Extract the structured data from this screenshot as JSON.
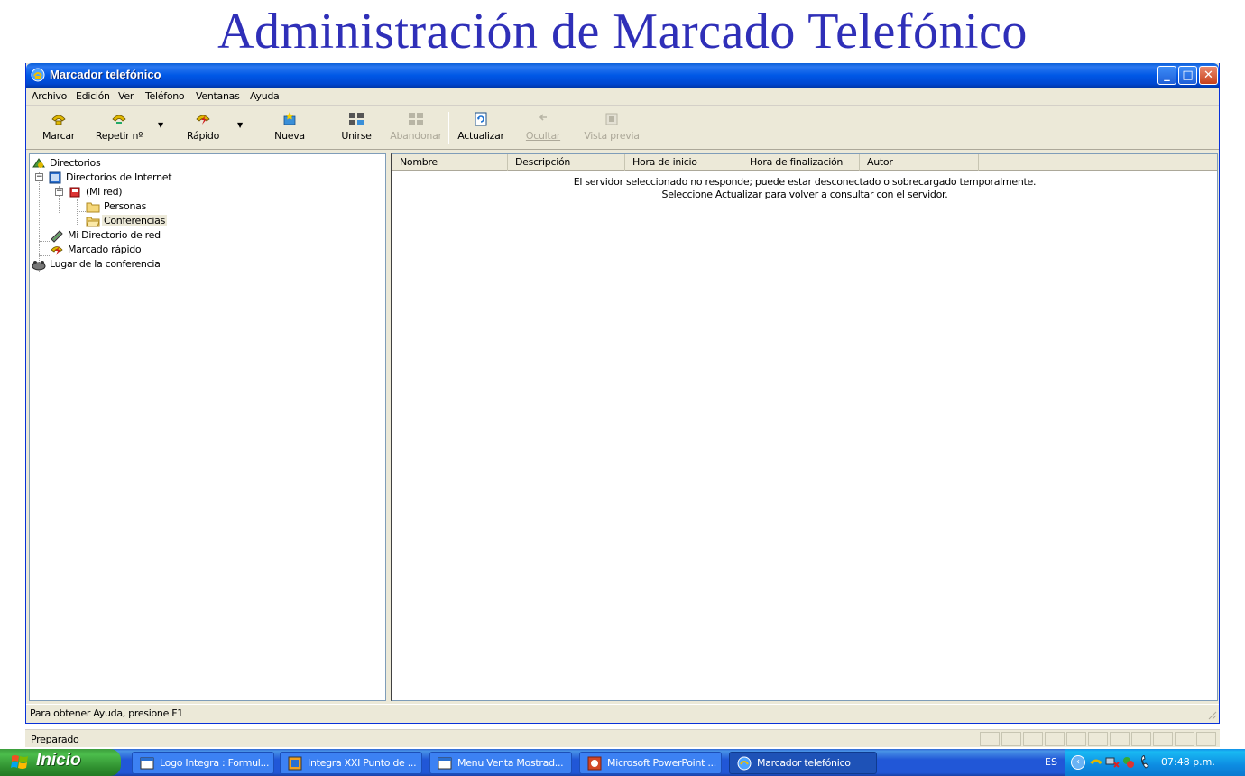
{
  "slide": {
    "title": "Administración de Marcado Telefónico"
  },
  "window": {
    "title": "Marcador telefónico",
    "controls": {
      "minimize": "_",
      "maximize": "□",
      "close": "✕"
    }
  },
  "menu": [
    "Archivo",
    "Edición",
    "Ver",
    "Teléfono",
    "Ventanas",
    "Ayuda"
  ],
  "toolbar": {
    "marcar": "Marcar",
    "repetir": "Repetir nº",
    "rapido": "Rápido",
    "nueva": "Nueva",
    "unirse": "Unirse",
    "abandonar": "Abandonar",
    "actualizar": "Actualizar",
    "ocultar": "Ocultar",
    "vista_previa": "Vista previa",
    "dropdown_glyph": "▼"
  },
  "tree": {
    "directorios": "Directorios",
    "internet": "Directorios de Internet",
    "mi_red": "(Mi red)",
    "personas": "Personas",
    "conferencias": "Conferencias",
    "mi_directorio": "Mi Directorio de red",
    "marcado_rapido": "Marcado rápido",
    "lugar": "Lugar de la conferencia",
    "collapse_glyph": "−"
  },
  "list": {
    "columns": [
      "Nombre",
      "Descripción",
      "Hora de inicio",
      "Hora de finalización",
      "Autor"
    ],
    "message_line1": "El servidor seleccionado no responde; puede estar desconectado o sobrecargado temporalmente.",
    "message_line2": "Seleccione Actualizar para volver a consultar con el servidor."
  },
  "status": {
    "window_status": "Para obtener Ayuda, presione F1",
    "outer_status": "Preparado"
  },
  "taskbar": {
    "start": "Inicio",
    "tasks": [
      "Logo Integra : Formul...",
      "Integra XXI Punto de ...",
      "Menu Venta Mostrad...",
      "Microsoft PowerPoint ...",
      "Marcador telefónico"
    ],
    "language": "ES",
    "chevron": "‹",
    "clock": "07:48 p.m."
  },
  "colors": {
    "title_blue": "#2f2fb8",
    "xp_blue": "#0058e6",
    "start_green": "#3c9d3c",
    "window_face": "#ece9d8"
  }
}
